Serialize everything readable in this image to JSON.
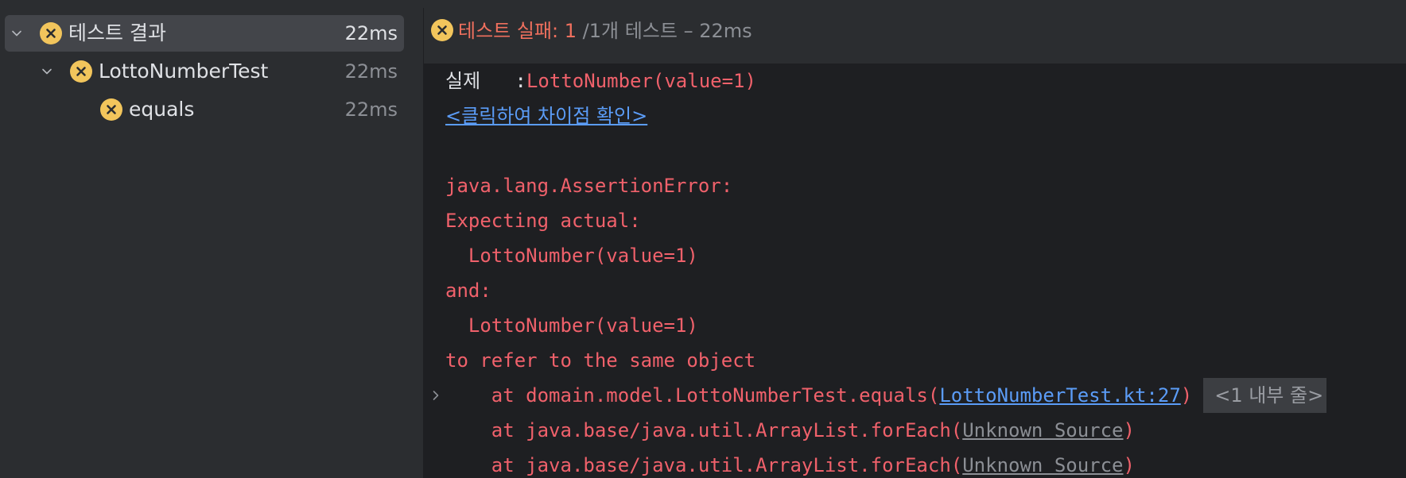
{
  "tree": {
    "items": [
      {
        "label": "테스트 결과",
        "time": "22ms"
      },
      {
        "label": "LottoNumberTest",
        "time": "22ms"
      },
      {
        "label": "equals",
        "time": "22ms"
      }
    ]
  },
  "status": {
    "fail_text": "테스트 실패: 1",
    "rest_text": " /1개 테스트 – 22ms"
  },
  "console": {
    "actual_label": "실제",
    "actual_colon": "   :",
    "actual_value": "LottoNumber(value=1)",
    "diff_link": "<클릭하여 차이점 확인>",
    "lines": [
      "java.lang.AssertionError:",
      "Expecting actual:",
      "  LottoNumber(value=1)",
      "and:",
      "  LottoNumber(value=1)",
      "to refer to the same object"
    ],
    "stack": [
      {
        "prefix": "    at domain.model.LottoNumberTest.equals(",
        "link": "LottoNumberTest.kt:27",
        "suffix": ")",
        "badge": "<1 내부 줄>"
      },
      {
        "prefix": "    at java.base/java.util.ArrayList.forEach(",
        "link": "Unknown Source",
        "suffix": ")"
      },
      {
        "prefix": "    at java.base/java.util.ArrayList.forEach(",
        "link": "Unknown Source",
        "suffix": ")"
      }
    ]
  },
  "colors": {
    "fail_yellow": "#f2c55c",
    "error_red": "#f0616b",
    "link_blue": "#5b9cf7"
  }
}
